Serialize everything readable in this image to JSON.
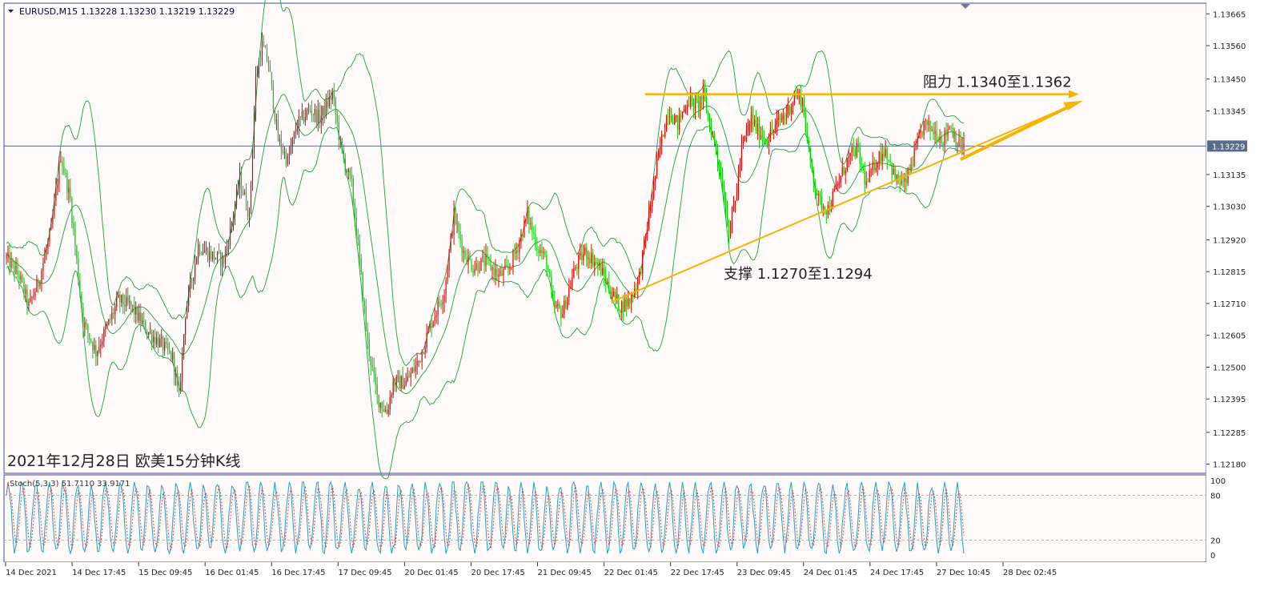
{
  "window": {
    "header_text": "EURUSD,M15  1.13228 1.13230 1.13219 1.13229",
    "header_icon": "dropdown-triangle-icon"
  },
  "colors": {
    "background": "#FFFAFA",
    "frame": "#4A4A8A",
    "bull_candle": "#E00000",
    "bear_candle": "#00D000",
    "bollinger": "#1F9D3F",
    "annotation": "#F5B400",
    "price_line": "#5A6A8A",
    "stoch_main": "#20A0C0",
    "stoch_signal": "#E04040",
    "current_price_bg": "#5A6A8A"
  },
  "chart_data": [
    {
      "type": "candlestick",
      "symbol": "EURUSD",
      "timeframe": "M15",
      "ohlc_readout": {
        "open": 1.13228,
        "high": 1.1323,
        "low": 1.13219,
        "close": 1.13229
      },
      "current_price": 1.13229,
      "current_price_label": "1.13229",
      "y_ticks": [
        "1.13665",
        "1.13560",
        "1.13450",
        "1.13345",
        "1.13135",
        "1.13030",
        "1.12920",
        "1.12815",
        "1.12710",
        "1.12605",
        "1.12500",
        "1.12395",
        "1.12285",
        "1.12180"
      ],
      "ylim": [
        1.1215,
        1.137
      ],
      "x_ticks": [
        "14 Dec 2021",
        "14 Dec 17:45",
        "15 Dec 09:45",
        "16 Dec 01:45",
        "16 Dec 17:45",
        "17 Dec 09:45",
        "20 Dec 01:45",
        "20 Dec 17:45",
        "21 Dec 09:45",
        "22 Dec 01:45",
        "22 Dec 17:45",
        "23 Dec 09:45",
        "24 Dec 01:45",
        "24 Dec 17:45",
        "27 Dec 10:45",
        "28 Dec 02:45"
      ],
      "price_path": [
        [
          0,
          1.1286
        ],
        [
          8,
          1.128
        ],
        [
          14,
          1.127
        ],
        [
          20,
          1.1278
        ],
        [
          28,
          1.1295
        ],
        [
          34,
          1.132
        ],
        [
          40,
          1.1305
        ],
        [
          48,
          1.1265
        ],
        [
          56,
          1.1255
        ],
        [
          62,
          1.1262
        ],
        [
          70,
          1.1272
        ],
        [
          78,
          1.127
        ],
        [
          88,
          1.1262
        ],
        [
          96,
          1.1258
        ],
        [
          104,
          1.1253
        ],
        [
          108,
          1.124
        ],
        [
          112,
          1.1268
        ],
        [
          120,
          1.129
        ],
        [
          128,
          1.1287
        ],
        [
          136,
          1.1285
        ],
        [
          140,
          1.1295
        ],
        [
          146,
          1.1312
        ],
        [
          152,
          1.13
        ],
        [
          156,
          1.1345
        ],
        [
          160,
          1.1356
        ],
        [
          164,
          1.135
        ],
        [
          170,
          1.1325
        ],
        [
          176,
          1.1318
        ],
        [
          182,
          1.133
        ],
        [
          190,
          1.1335
        ],
        [
          196,
          1.1332
        ],
        [
          204,
          1.134
        ],
        [
          210,
          1.132
        ],
        [
          216,
          1.131
        ],
        [
          220,
          1.129
        ],
        [
          226,
          1.1258
        ],
        [
          232,
          1.124
        ],
        [
          238,
          1.1235
        ],
        [
          242,
          1.1245
        ],
        [
          250,
          1.1245
        ],
        [
          258,
          1.1252
        ],
        [
          266,
          1.1265
        ],
        [
          274,
          1.1275
        ],
        [
          280,
          1.13
        ],
        [
          286,
          1.1288
        ],
        [
          292,
          1.1283
        ],
        [
          300,
          1.1285
        ],
        [
          308,
          1.128
        ],
        [
          314,
          1.1282
        ],
        [
          320,
          1.129
        ],
        [
          326,
          1.13
        ],
        [
          332,
          1.129
        ],
        [
          338,
          1.1285
        ],
        [
          342,
          1.127
        ],
        [
          348,
          1.1268
        ],
        [
          356,
          1.1283
        ],
        [
          362,
          1.1288
        ],
        [
          368,
          1.1285
        ],
        [
          372,
          1.1282
        ],
        [
          378,
          1.1275
        ],
        [
          384,
          1.127
        ],
        [
          390,
          1.1272
        ],
        [
          396,
          1.128
        ],
        [
          402,
          1.13
        ],
        [
          408,
          1.132
        ],
        [
          414,
          1.1335
        ],
        [
          420,
          1.133
        ],
        [
          426,
          1.1338
        ],
        [
          432,
          1.1336
        ],
        [
          436,
          1.134
        ],
        [
          440,
          1.133
        ],
        [
          444,
          1.1322
        ],
        [
          448,
          1.131
        ],
        [
          452,
          1.1295
        ],
        [
          456,
          1.1305
        ],
        [
          460,
          1.1322
        ],
        [
          466,
          1.1332
        ],
        [
          470,
          1.1328
        ],
        [
          476,
          1.1325
        ],
        [
          482,
          1.133
        ],
        [
          488,
          1.1334
        ],
        [
          494,
          1.134
        ],
        [
          498,
          1.1338
        ],
        [
          502,
          1.132
        ],
        [
          508,
          1.1305
        ],
        [
          514,
          1.1302
        ],
        [
          520,
          1.131
        ],
        [
          526,
          1.1318
        ],
        [
          532,
          1.1322
        ],
        [
          538,
          1.131
        ],
        [
          544,
          1.1318
        ],
        [
          550,
          1.1322
        ],
        [
          556,
          1.1312
        ],
        [
          562,
          1.131
        ],
        [
          568,
          1.132
        ],
        [
          574,
          1.133
        ],
        [
          580,
          1.1328
        ],
        [
          586,
          1.1325
        ],
        [
          590,
          1.133
        ],
        [
          596,
          1.1323
        ]
      ],
      "bollinger_width": 0.0013,
      "annotations": [
        {
          "label": "阻力 1.1340至1.1362",
          "kind": "resistance-arrow"
        },
        {
          "label": "支撑 1.1270至1.1294",
          "kind": "support-line"
        }
      ],
      "caption": "2021年12月28日 欧美15分钟K线"
    },
    {
      "type": "line",
      "indicator": "Stochastic",
      "title": "Stoch(5,3,3) 51.7110 33.9171",
      "main_value": 51.711,
      "signal_value": 33.9171,
      "y_ticks": [
        "100",
        "80",
        "20",
        "0"
      ],
      "levels": [
        80,
        20
      ],
      "ylim": [
        0,
        100
      ]
    }
  ]
}
